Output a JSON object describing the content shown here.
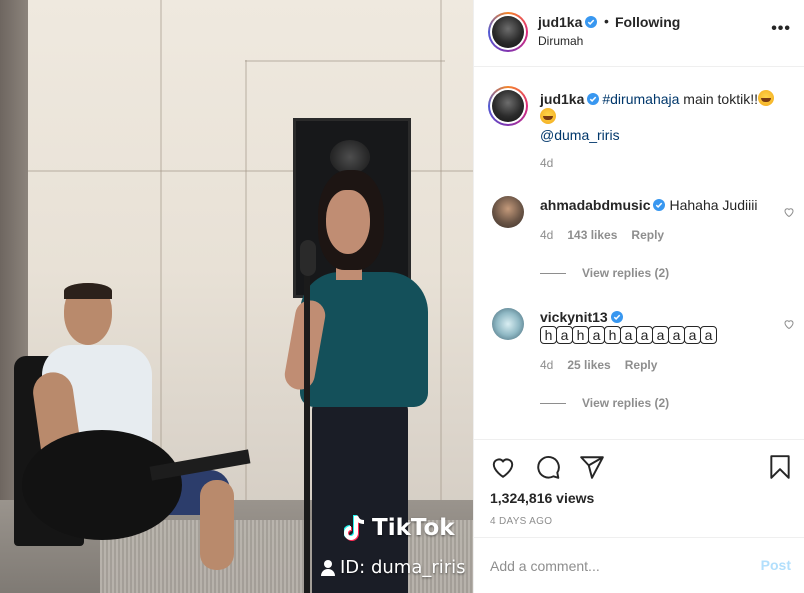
{
  "video": {
    "watermark_brand": "TikTok",
    "watermark_id": "ID: duma_riris"
  },
  "header": {
    "username": "jud1ka",
    "separator": "•",
    "follow_status": "Following",
    "location": "Dirumah",
    "more_label": "•••"
  },
  "caption": {
    "username": "jud1ka",
    "hashtag": "#dirumahaja",
    "text": " main toktik!!",
    "mention": "@duma_riris",
    "time": "4d"
  },
  "comments": [
    {
      "username": "ahmadabdmusic",
      "text": "Hahaha Judiiii",
      "time": "4d",
      "likes": "143 likes",
      "reply_label": "Reply",
      "view_replies": "View replies (2)"
    },
    {
      "username": "vickynit13",
      "boxed_chars": [
        "h",
        "a",
        "h",
        "a",
        "h",
        "a",
        "a",
        "a",
        "a",
        "a",
        "a"
      ],
      "time": "4d",
      "likes": "25 likes",
      "reply_label": "Reply",
      "view_replies": "View replies (2)"
    }
  ],
  "stats": {
    "views": "1,324,816 views",
    "posted": "4 DAYS AGO"
  },
  "add_comment": {
    "placeholder": "Add a comment...",
    "post_label": "Post"
  },
  "icons": {
    "like": "heart-icon",
    "comment": "comment-icon",
    "share": "share-icon",
    "save": "bookmark-icon",
    "verified": "verified-badge-icon"
  },
  "colors": {
    "verified_blue": "#3897f0",
    "link": "#00376b",
    "muted": "#8e8e8e",
    "post_disabled": "#b2dffc"
  }
}
